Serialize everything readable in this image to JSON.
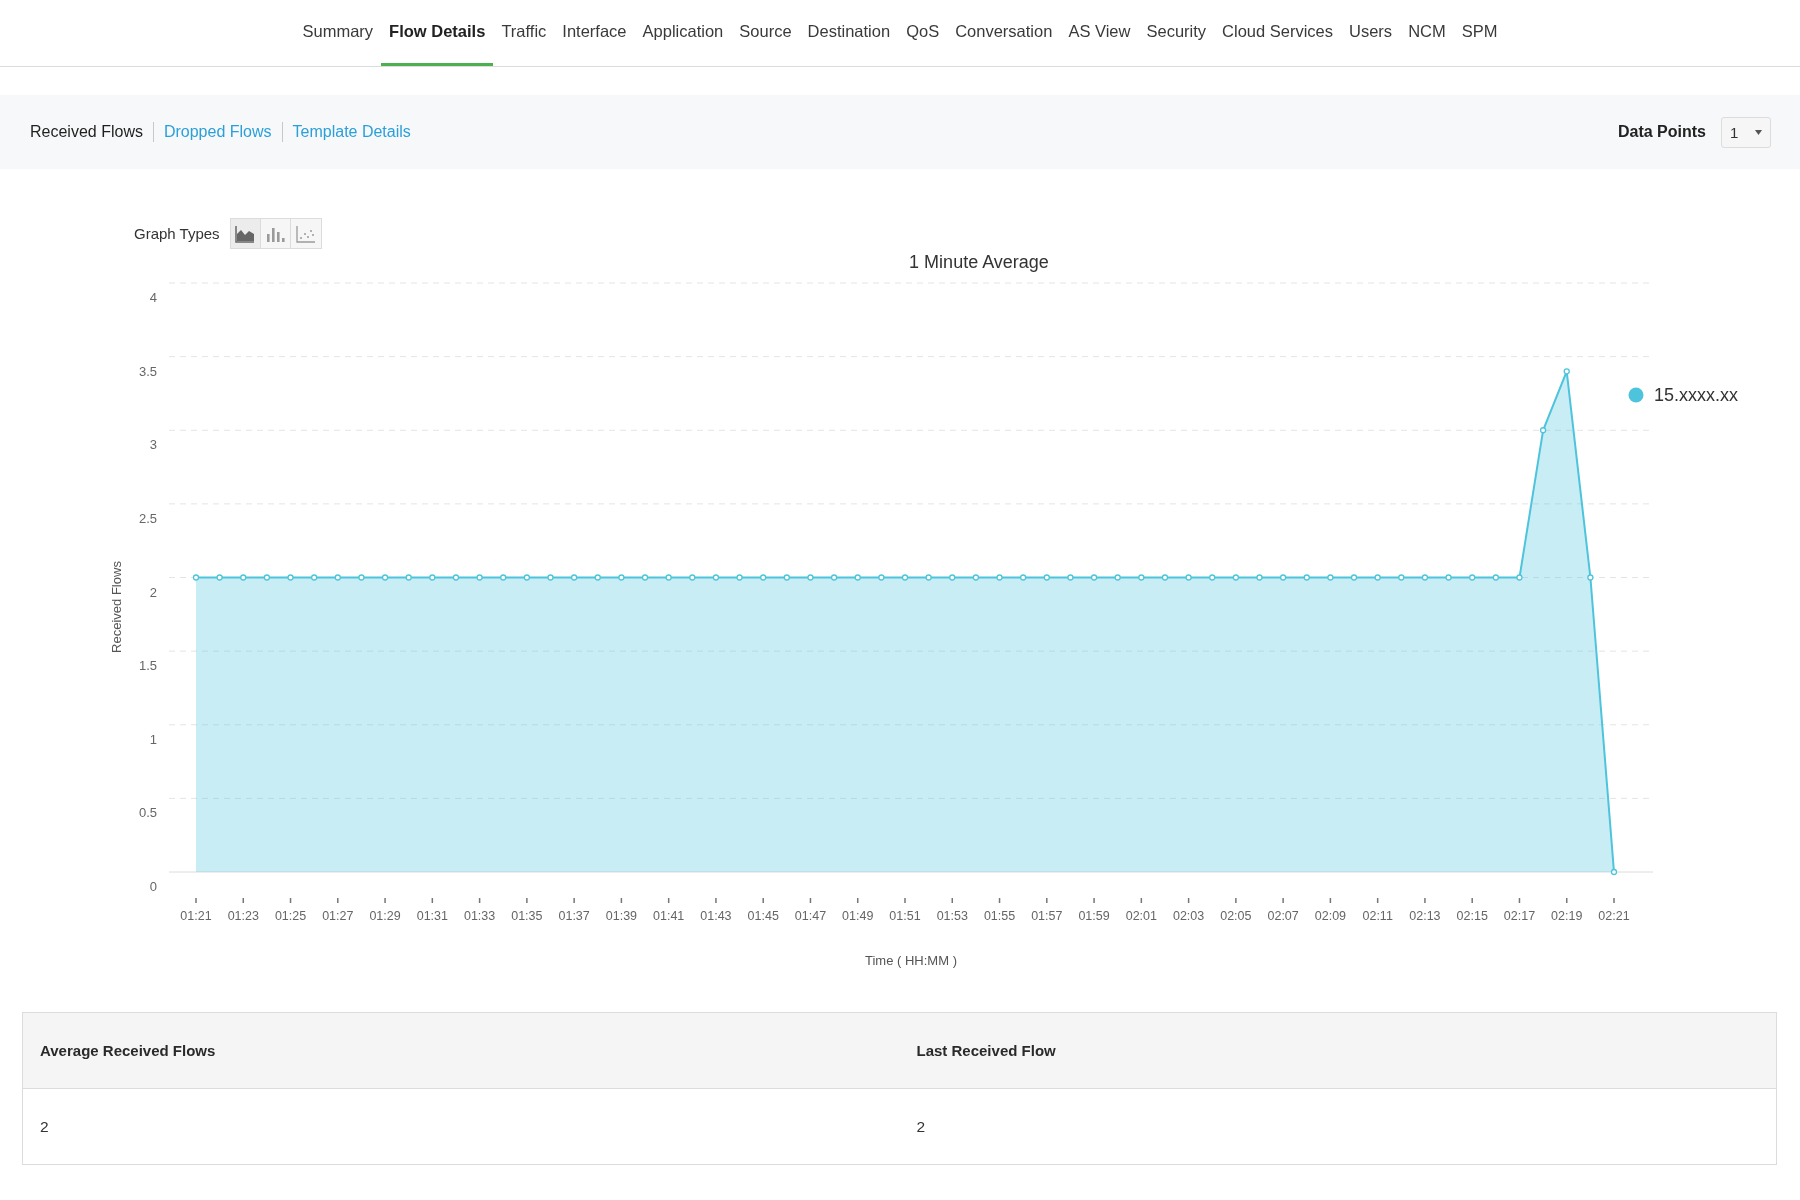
{
  "nav": {
    "tabs": [
      {
        "label": "Summary",
        "selected": false
      },
      {
        "label": "Flow Details",
        "selected": true
      },
      {
        "label": "Traffic",
        "selected": false
      },
      {
        "label": "Interface",
        "selected": false
      },
      {
        "label": "Application",
        "selected": false
      },
      {
        "label": "Source",
        "selected": false
      },
      {
        "label": "Destination",
        "selected": false
      },
      {
        "label": "QoS",
        "selected": false
      },
      {
        "label": "Conversation",
        "selected": false
      },
      {
        "label": "AS View",
        "selected": false
      },
      {
        "label": "Security",
        "selected": false
      },
      {
        "label": "Cloud Services",
        "selected": false
      },
      {
        "label": "Users",
        "selected": false
      },
      {
        "label": "NCM",
        "selected": false
      },
      {
        "label": "SPM",
        "selected": false
      }
    ]
  },
  "subnav": {
    "links": [
      {
        "label": "Received Flows",
        "selected": true
      },
      {
        "label": "Dropped Flows",
        "selected": false
      },
      {
        "label": "Template Details",
        "selected": false
      }
    ],
    "data_points": {
      "label": "Data Points",
      "value": "1"
    }
  },
  "graph": {
    "graph_types": {
      "label": "Graph Types",
      "options": [
        {
          "kind": "area",
          "selected": true
        },
        {
          "kind": "bar",
          "selected": false
        },
        {
          "kind": "scatter",
          "selected": false
        }
      ]
    },
    "chart_data": {
      "type": "area",
      "title": "1 Minute Average",
      "xlabel": "Time ( HH:MM )",
      "ylabel": "Received Flows",
      "categories": [
        "01:21",
        null,
        "01:23",
        null,
        "01:25",
        null,
        "01:27",
        null,
        "01:29",
        null,
        "01:31",
        null,
        "01:33",
        null,
        "01:35",
        null,
        "01:37",
        null,
        "01:39",
        null,
        "01:41",
        null,
        "01:43",
        null,
        "01:45",
        null,
        "01:47",
        null,
        "01:49",
        null,
        "01:51",
        null,
        "01:53",
        null,
        "01:55",
        null,
        "01:57",
        null,
        "01:59",
        null,
        "02:01",
        null,
        "02:03",
        null,
        "02:05",
        null,
        "02:07",
        null,
        "02:09",
        null,
        "02:11",
        null,
        "02:13",
        null,
        "02:15",
        null,
        "02:17",
        null,
        "02:19",
        null,
        "02:21"
      ],
      "series": [
        {
          "name": "15.xxxx.xx",
          "color": "#4dc4dc",
          "values": [
            2,
            2,
            2,
            2,
            2,
            2,
            2,
            2,
            2,
            2,
            2,
            2,
            2,
            2,
            2,
            2,
            2,
            2,
            2,
            2,
            2,
            2,
            2,
            2,
            2,
            2,
            2,
            2,
            2,
            2,
            2,
            2,
            2,
            2,
            2,
            2,
            2,
            2,
            2,
            2,
            2,
            2,
            2,
            2,
            2,
            2,
            2,
            2,
            2,
            2,
            2,
            2,
            2,
            2,
            2,
            2,
            2,
            3,
            3.4,
            2,
            0
          ]
        }
      ],
      "ylim": [
        0,
        4
      ],
      "yticks": [
        0,
        0.5,
        1,
        1.5,
        2,
        2.5,
        3,
        3.5,
        4
      ],
      "grid": true
    }
  },
  "table": {
    "columns": [
      "Average Received Flows",
      "Last Received Flow"
    ],
    "rows": [
      [
        "2",
        "2"
      ]
    ]
  }
}
